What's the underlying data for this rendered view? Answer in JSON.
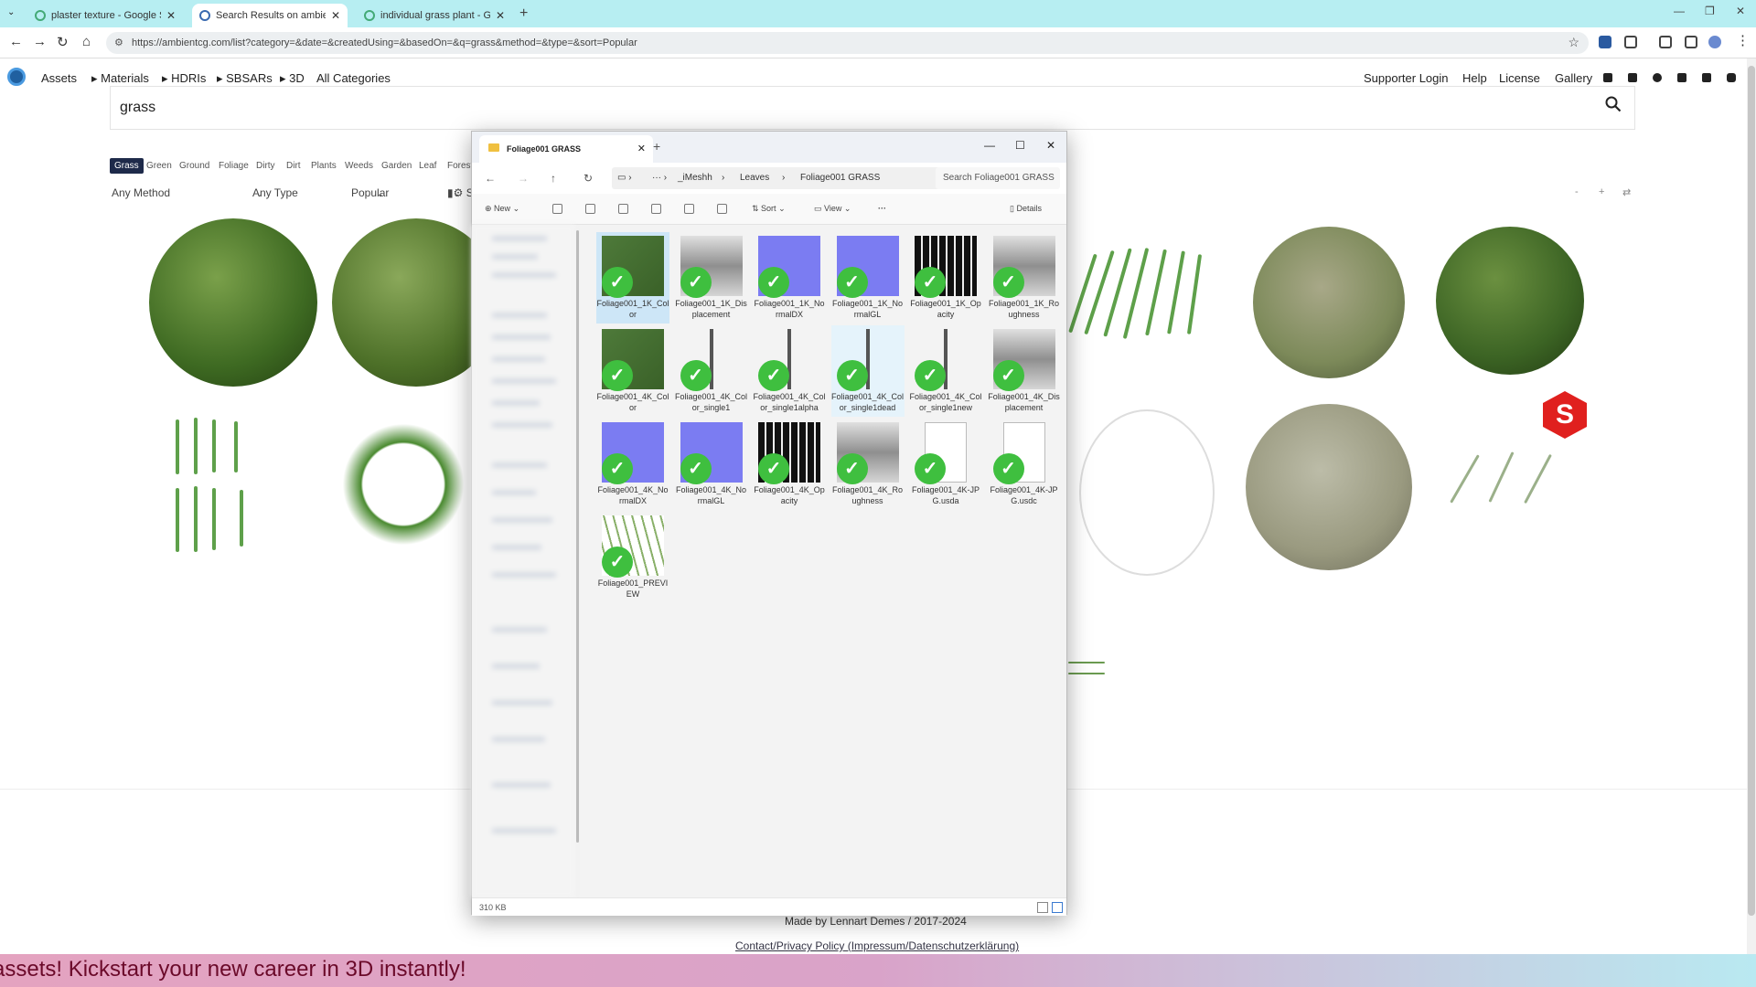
{
  "browser": {
    "tabs": [
      {
        "title": "plaster texture - Google Search"
      },
      {
        "title": "Search Results on ambientCG"
      },
      {
        "title": "individual grass plant - Google"
      }
    ],
    "url": "https://ambientcg.com/list?category=&date=&createdUsing=&basedOn=&q=grass&method=&type=&sort=Popular"
  },
  "site": {
    "nav": [
      "Assets",
      "▸ Materials",
      "▸ HDRIs",
      "▸ SBSARs",
      "▸ 3D",
      "All Categories"
    ],
    "right_nav": [
      "Supporter Login",
      "Help",
      "License",
      "Gallery"
    ],
    "search_value": "grass",
    "chips": [
      "Grass",
      "Green",
      "Ground",
      "Foliage",
      "Dirty",
      "Dirt",
      "Plants",
      "Weeds",
      "Garden",
      "Leaf",
      "Forest"
    ],
    "filters": {
      "method": "Any Method",
      "type": "Any Type",
      "sort": "Popular",
      "extra": "Su"
    },
    "footer": {
      "made_by": "Made by Lennart Demes / 2017-2024",
      "contact": "Contact/Privacy Policy (Impressum/Datenschutzerklärung)"
    }
  },
  "banner": {
    "text": "assets! Kickstart your new career in 3D instantly!"
  },
  "explorer": {
    "tab_title": "Foliage001 GRASS",
    "breadcrumb": [
      "_iMeshh",
      "Leaves",
      "Foliage001 GRASS"
    ],
    "search_placeholder": "Search Foliage001 GRASS",
    "toolbar": {
      "new": "New",
      "sort": "Sort",
      "view": "View",
      "details": "Details"
    },
    "status": "310 KB",
    "files": [
      {
        "name": "Foliage001_1K_Color",
        "kind": "color"
      },
      {
        "name": "Foliage001_1K_Displacement",
        "kind": "gray"
      },
      {
        "name": "Foliage001_1K_NormalDX",
        "kind": "normal"
      },
      {
        "name": "Foliage001_1K_NormalGL",
        "kind": "normal"
      },
      {
        "name": "Foliage001_1K_Opacity",
        "kind": "opacity"
      },
      {
        "name": "Foliage001_1K_Roughness",
        "kind": "gray"
      },
      {
        "name": "Foliage001_4K_Color",
        "kind": "color"
      },
      {
        "name": "Foliage001_4K_Color_single1",
        "kind": "blade"
      },
      {
        "name": "Foliage001_4K_Color_single1alpha",
        "kind": "blade"
      },
      {
        "name": "Foliage001_4K_Color_single1dead",
        "kind": "blade"
      },
      {
        "name": "Foliage001_4K_Color_single1new",
        "kind": "blade"
      },
      {
        "name": "Foliage001_4K_Displacement",
        "kind": "gray"
      },
      {
        "name": "Foliage001_4K_NormalDX",
        "kind": "normal"
      },
      {
        "name": "Foliage001_4K_NormalGL",
        "kind": "normal"
      },
      {
        "name": "Foliage001_4K_Opacity",
        "kind": "opacity"
      },
      {
        "name": "Foliage001_4K_Roughness",
        "kind": "gray"
      },
      {
        "name": "Foliage001_4K-JPG.usda",
        "kind": "doc"
      },
      {
        "name": "Foliage001_4K-JPG.usdc",
        "kind": "doc"
      },
      {
        "name": "Foliage001_PREVIEW",
        "kind": "preview"
      }
    ]
  }
}
